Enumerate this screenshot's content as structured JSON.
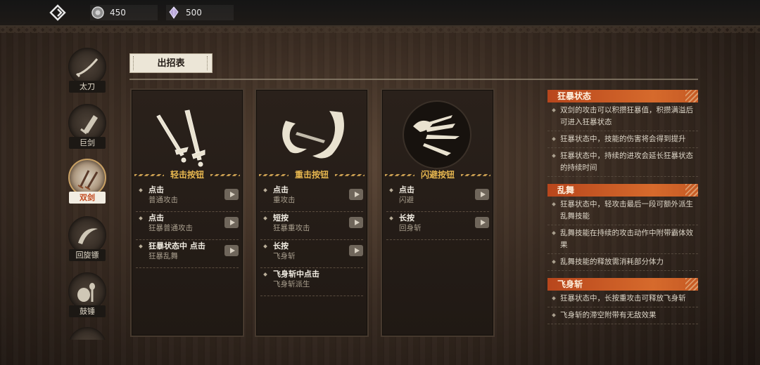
{
  "currency": [
    {
      "icon": "coin-icon",
      "value": "450"
    },
    {
      "icon": "crystal-icon",
      "value": "500"
    }
  ],
  "sidebar": {
    "items": [
      {
        "label": "太刀",
        "icon": "katana-icon",
        "active": false
      },
      {
        "label": "巨剑",
        "icon": "greatsword-icon",
        "active": false
      },
      {
        "label": "双剑",
        "icon": "dual-blades-icon",
        "active": true
      },
      {
        "label": "回旋镖",
        "icon": "boomerang-icon",
        "active": false
      },
      {
        "label": "鼓锤",
        "icon": "drum-hammer-icon",
        "active": false
      }
    ]
  },
  "tab": {
    "label": "出招表"
  },
  "panels": [
    {
      "title": "轻击按钮",
      "icon": "dual-swords-icon",
      "moves": [
        {
          "name": "点击",
          "desc": "普通攻击"
        },
        {
          "name": "点击",
          "desc": "狂暴普通攻击"
        },
        {
          "name": "狂暴状态中 点击",
          "desc": "狂暴乱舞"
        }
      ]
    },
    {
      "title": "重击按钮",
      "icon": "slash-swirl-icon",
      "moves": [
        {
          "name": "点击",
          "desc": "重攻击"
        },
        {
          "name": "短按",
          "desc": "狂暴重攻击"
        },
        {
          "name": "长按",
          "desc": "飞身斩"
        },
        {
          "name": "飞身斩中点击",
          "desc": "飞身斩派生"
        }
      ]
    },
    {
      "title": "闪避按钮",
      "icon": "dash-dodge-icon",
      "moves": [
        {
          "name": "点击",
          "desc": "闪避"
        },
        {
          "name": "长按",
          "desc": "回身斩"
        }
      ]
    }
  ],
  "info": [
    {
      "title": "狂暴状态",
      "bullets": [
        "双剑的攻击可以积攒狂暴值，积攒满溢后可进入狂暴状态",
        "狂暴状态中，技能的伤害将会得到提升",
        "狂暴状态中，持续的进攻会延长狂暴状态的持续时间"
      ]
    },
    {
      "title": "乱舞",
      "bullets": [
        "狂暴状态中，轻攻击最后一段可额外派生乱舞技能",
        "乱舞技能在持续的攻击动作中附带霸体效果",
        "乱舞技能的释放需消耗部分体力"
      ]
    },
    {
      "title": "飞身斩",
      "bullets": [
        "狂暴状态中，长按重攻击可释放飞身斩",
        "飞身斩的滞空附带有无敌效果"
      ]
    }
  ]
}
